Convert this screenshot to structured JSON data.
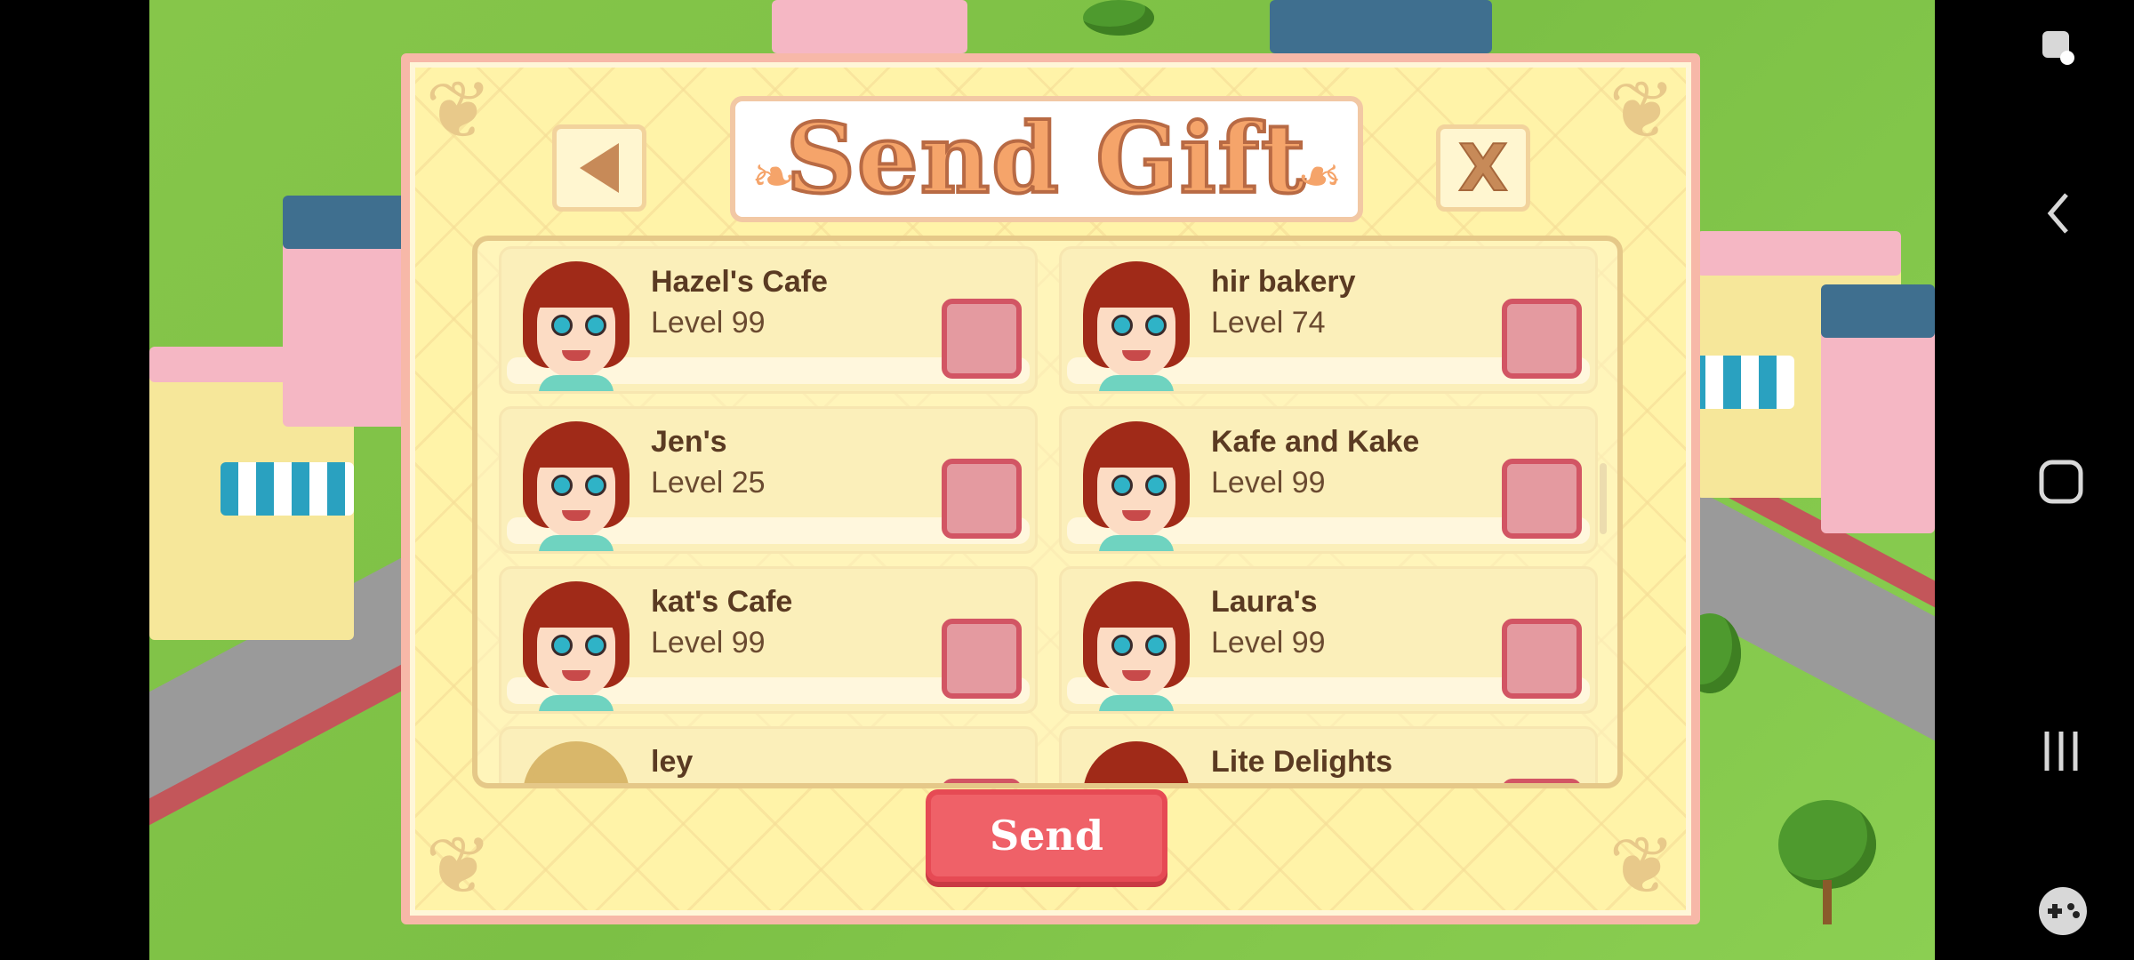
{
  "dialog": {
    "title": "Send Gift",
    "back_icon": "back-arrow-icon",
    "close_label": "X",
    "send_label": "Send"
  },
  "friends": [
    {
      "name": "Hazel's Cafe",
      "level": "Level 99",
      "checked": false,
      "hair": "red"
    },
    {
      "name": "hir bakery",
      "level": "Level 74",
      "checked": false,
      "hair": "red"
    },
    {
      "name": "Jen's",
      "level": "Level 25",
      "checked": false,
      "hair": "red"
    },
    {
      "name": "Kafe and Kake",
      "level": "Level 99",
      "checked": false,
      "hair": "red"
    },
    {
      "name": "kat's Cafe",
      "level": "Level 99",
      "checked": false,
      "hair": "red"
    },
    {
      "name": "Laura's",
      "level": "Level 99",
      "checked": false,
      "hair": "red"
    },
    {
      "name": "ley",
      "level": "",
      "checked": false,
      "hair": "blonde"
    },
    {
      "name": "Lite Delights",
      "level": "",
      "checked": false,
      "hair": "red"
    }
  ],
  "system_nav": {
    "icons": [
      "game-tools-icon",
      "back-icon",
      "home-icon",
      "recents-icon",
      "gamepad-icon"
    ]
  }
}
